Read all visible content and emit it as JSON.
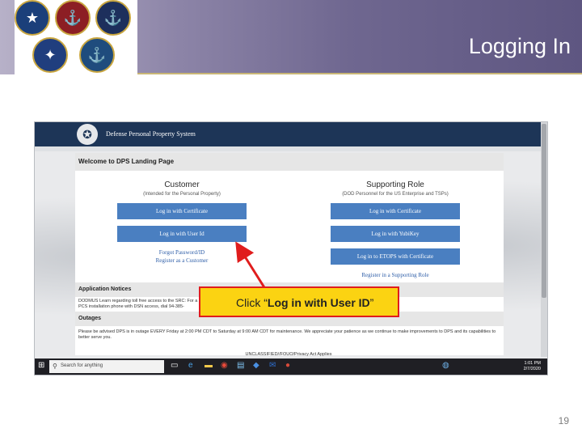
{
  "slide": {
    "title": "Logging In",
    "page_number": "19"
  },
  "dps": {
    "system_name": "Defense Personal Property System",
    "welcome": "Welcome to DPS Landing Page",
    "customer": {
      "title": "Customer",
      "subtitle": "(Intended for the Personal Property)",
      "buttons": [
        "Log in with Certificate",
        "Log in with User Id"
      ],
      "links": [
        "Forgot Password/ID",
        "Register as a Customer"
      ]
    },
    "supporting": {
      "title": "Supporting Role",
      "subtitle": "(DOD Personnel for the US Enterprise and TSPs)",
      "buttons": [
        "Log in with Certificate",
        "Log in with YubiKey",
        "Log in to ETOPS with Certificate"
      ],
      "links": [
        "Register in a Supporting Role"
      ]
    },
    "notices_title": "Application Notices",
    "notice_text": "DODMUS Learn regarding toll free access to the SRC: For a PCS installation phone with DSN access, dial 94-385-",
    "outages_title": "Outages",
    "outage_text": "Please be advised DPS is in outage EVERY Friday at 2:00 PM CDT to Saturday at 9:00 AM CDT for maintenance. We appreciate your patience as we continue to make improvements to DPS and its capabilities to better serve you.",
    "footer": "UNCLASSIFIED//FOUO/Privacy Act Applies"
  },
  "taskbar": {
    "search_placeholder": "Search for anything",
    "time": "1:01 PM",
    "date": "2/7/2020"
  },
  "callout": {
    "prefix": "Click “",
    "emphasis": "Log in with User ID",
    "suffix": "”"
  },
  "colors": {
    "callout_fill": "#fbd312",
    "callout_border": "#e01d1d",
    "dps_button": "#4a7fc1",
    "dps_header": "#1d3557"
  }
}
